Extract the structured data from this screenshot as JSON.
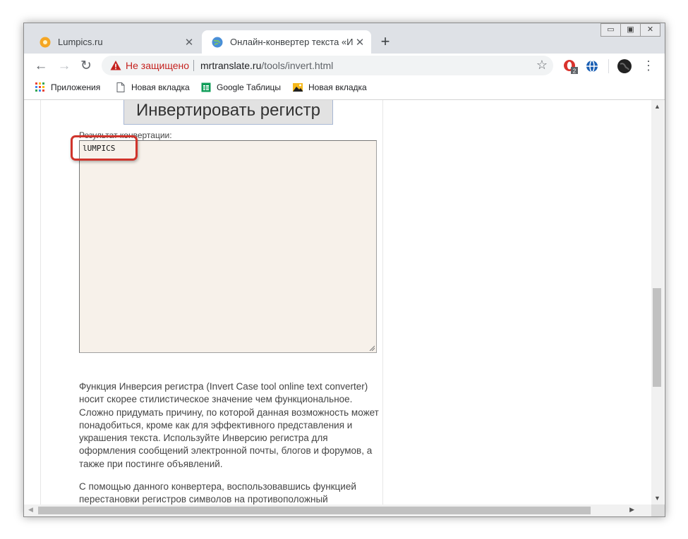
{
  "tabs": [
    {
      "title": "Lumpics.ru",
      "favicon": "lumpics-icon",
      "active": false
    },
    {
      "title": "Онлайн-конвертер текста «Инв",
      "favicon": "globe-icon",
      "active": true
    }
  ],
  "new_tab_label": "+",
  "window_controls": {
    "minimize": "▭",
    "maximize": "▣",
    "close": "✕"
  },
  "nav": {
    "back": "←",
    "forward": "→",
    "reload": "↻"
  },
  "omnibox": {
    "security_label": "Не защищено",
    "url_host": "mrtranslate.ru",
    "url_path": "/tools/invert.html",
    "star": "☆"
  },
  "extensions": [
    {
      "name": "opera-extension-icon",
      "badge": "2"
    },
    {
      "name": "vpn-extension-icon"
    },
    {
      "name": "profile-avatar"
    }
  ],
  "menu_label": "⋮",
  "bookmarks": [
    {
      "label": "Приложения",
      "icon": "apps-grid-icon"
    },
    {
      "label": "Новая вкладка",
      "icon": "page-icon"
    },
    {
      "label": "Google Таблицы",
      "icon": "sheets-icon"
    },
    {
      "label": "Новая вкладка",
      "icon": "image-icon"
    }
  ],
  "page": {
    "invert_button": "Инвертировать регистр",
    "result_label": "Результат конвертации:",
    "result_value": "lUMPICS",
    "description": "Функция Инверсия регистра (Invert Case tool online text converter) носит скорее стилистическое значение чем функциональное. Сложно придумать причину, по которой данная возможность может понадобиться, кроме как для эффективного представления и украшения текста. Используйте Инверсию регистра для оформления сообщений электронной почты, блогов и форумов, а также при постинге объявлений.",
    "description2": "С помощью данного конвертера, воспользовавшись функцией перестановки регистров символов на противоположный"
  },
  "colors": {
    "highlight": "#d0342c",
    "textarea_bg": "#f7f1ea",
    "not_secure": "#c5221f"
  }
}
